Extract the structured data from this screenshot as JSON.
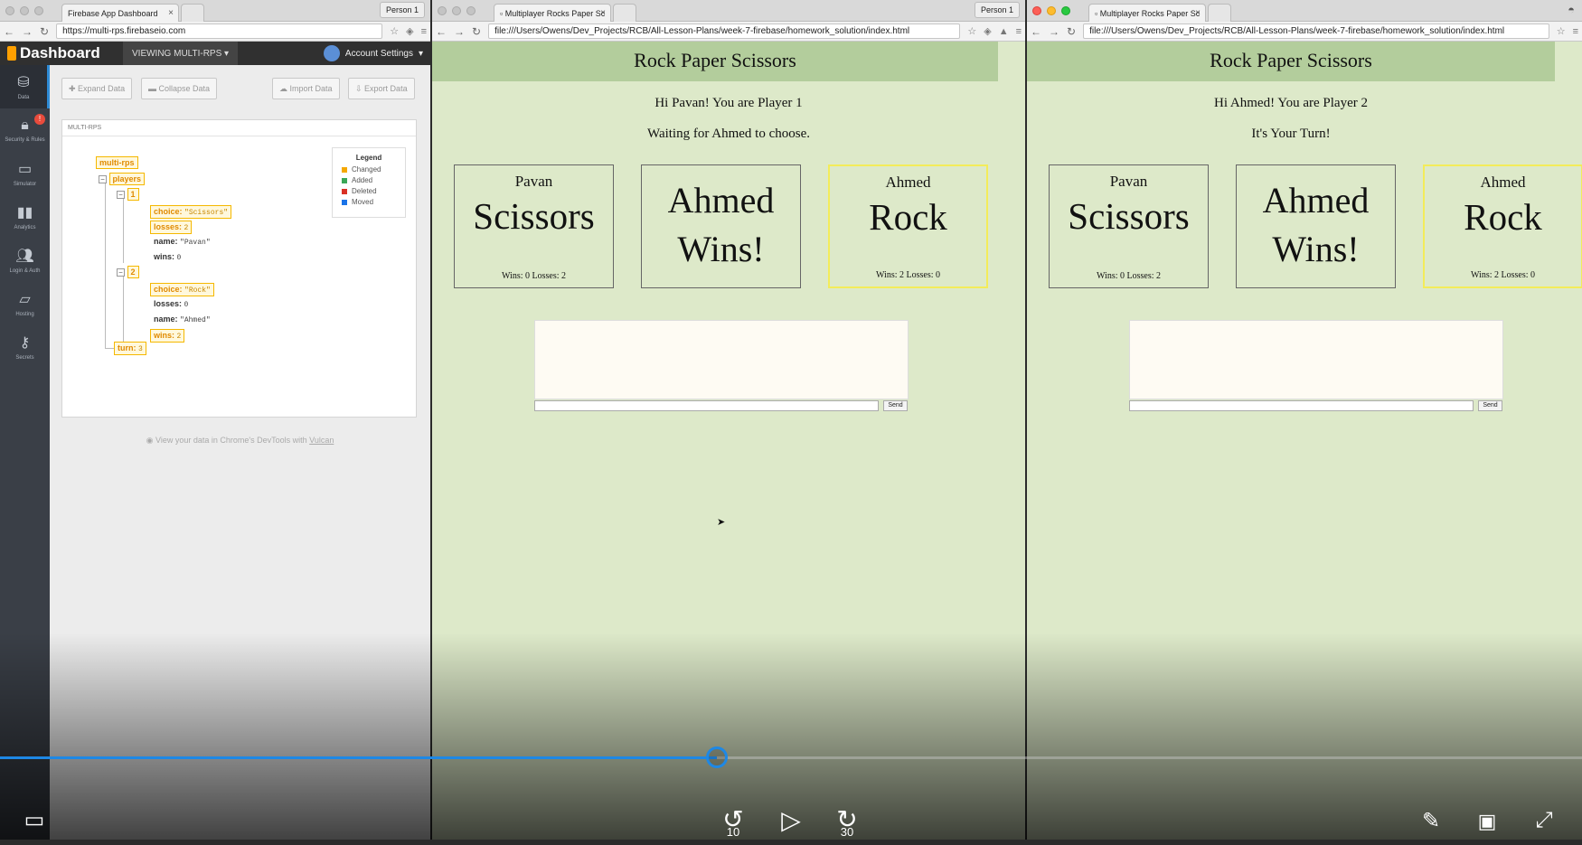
{
  "windows": {
    "firebase": {
      "tab_title": "Firebase App Dashboard",
      "person": "Person 1",
      "url": "https://multi-rps.firebaseio.com",
      "header": {
        "logo": "Dashboard",
        "viewing": "VIEWING MULTI-RPS",
        "account": "Account Settings"
      },
      "sidebar": [
        {
          "label": "Data",
          "icon": "database-icon"
        },
        {
          "label": "Security & Rules",
          "icon": "lock-icon",
          "badge": "!"
        },
        {
          "label": "Simulator",
          "icon": "laptop-icon"
        },
        {
          "label": "Analytics",
          "icon": "bar-chart-icon"
        },
        {
          "label": "Login & Auth",
          "icon": "users-icon"
        },
        {
          "label": "Hosting",
          "icon": "folder-icon"
        },
        {
          "label": "Secrets",
          "icon": "key-icon"
        }
      ],
      "toolbar": {
        "expand": "Expand Data",
        "collapse": "Collapse Data",
        "import": "Import Data",
        "export": "Export Data"
      },
      "breadcrumb": "MULTI-RPS",
      "tree": {
        "root": "multi-rps",
        "players_key": "players",
        "p1_key": "1",
        "p1_choice_k": "choice:",
        "p1_choice_v": "\"Scissors\"",
        "p1_losses_k": "losses:",
        "p1_losses_v": "2",
        "p1_name_k": "name:",
        "p1_name_v": "\"Pavan\"",
        "p1_wins_k": "wins:",
        "p1_wins_v": "0",
        "p2_key": "2",
        "p2_choice_k": "choice:",
        "p2_choice_v": "\"Rock\"",
        "p2_losses_k": "losses:",
        "p2_losses_v": "0",
        "p2_name_k": "name:",
        "p2_name_v": "\"Ahmed\"",
        "p2_wins_k": "wins:",
        "p2_wins_v": "2",
        "turn_k": "turn:",
        "turn_v": "3"
      },
      "legend": {
        "title": "Legend",
        "items": [
          {
            "label": "Changed",
            "color": "#f5a800"
          },
          {
            "label": "Added",
            "color": "#3aa757"
          },
          {
            "label": "Deleted",
            "color": "#d93025"
          },
          {
            "label": "Moved",
            "color": "#1a73e8"
          }
        ]
      },
      "vulcan_text": "View your data in Chrome's DevTools with",
      "vulcan_link": "Vulcan"
    },
    "player1": {
      "tab_title": "Multiplayer Rocks Paper Sc",
      "person": "Person 1",
      "url": "file:///Users/Owens/Dev_Projects/RCB/All-Lesson-Plans/week-7-firebase/homework_solution/index.html",
      "title": "Rock Paper Scissors",
      "greeting": "Hi Pavan! You are Player 1",
      "status": "Waiting for Ahmed to choose.",
      "left": {
        "name": "Pavan",
        "choice": "Scissors",
        "record": "Wins: 0 Losses: 2"
      },
      "result_line1": "Ahmed",
      "result_line2": "Wins!",
      "right": {
        "name": "Ahmed",
        "choice": "Rock",
        "record": "Wins: 2 Losses: 0"
      },
      "send": "Send"
    },
    "player2": {
      "tab_title": "Multiplayer Rocks Paper Sc",
      "url": "file:///Users/Owens/Dev_Projects/RCB/All-Lesson-Plans/week-7-firebase/homework_solution/index.html",
      "title": "Rock Paper Scissors",
      "greeting": "Hi Ahmed! You are Player 2",
      "status": "It's Your Turn!",
      "left": {
        "name": "Pavan",
        "choice": "Scissors",
        "record": "Wins: 0 Losses: 2"
      },
      "result_line1": "Ahmed",
      "result_line2": "Wins!",
      "right": {
        "name": "Ahmed",
        "choice": "Rock",
        "record": "Wins: 2 Losses: 0"
      },
      "send": "Send"
    }
  },
  "player": {
    "progress_fraction": 0.453,
    "rewind_label": "10",
    "forward_label": "30",
    "accent": "#1e88e5"
  }
}
